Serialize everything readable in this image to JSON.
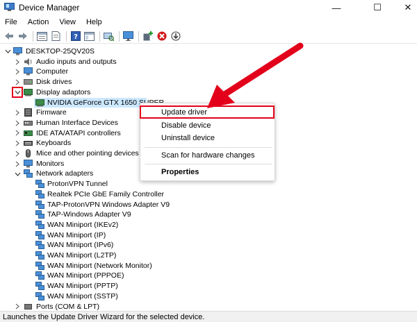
{
  "window": {
    "title": "Device Manager",
    "min_glyph": "—",
    "max_glyph": "☐",
    "close_glyph": "✕"
  },
  "menu": [
    "File",
    "Action",
    "View",
    "Help"
  ],
  "toolbar": {
    "icons": [
      "back-arrow-icon",
      "forward-arrow-icon",
      "properties-window-icon",
      "document-icon",
      "help-icon",
      "toolbar-window-icon",
      "scan-hardware-icon",
      "monitor-icon",
      "add-driver-icon",
      "remove-device-icon",
      "download-icon"
    ]
  },
  "tree": {
    "root": "DESKTOP-25QV20S",
    "items": [
      {
        "label": "Audio inputs and outputs",
        "icon": "speaker-icon"
      },
      {
        "label": "Computer",
        "icon": "computer-icon"
      },
      {
        "label": "Disk drives",
        "icon": "disk-icon"
      },
      {
        "label": "Display adaptors",
        "icon": "display-adapter-icon",
        "expanded": true
      },
      {
        "label": "NVIDIA GeForce GTX 1650 SUPER",
        "icon": "display-adapter-icon",
        "child": true,
        "selected": true
      },
      {
        "label": "Firmware",
        "icon": "firmware-icon"
      },
      {
        "label": "Human Interface Devices",
        "icon": "hid-icon"
      },
      {
        "label": "IDE ATA/ATAPI controllers",
        "icon": "ide-controller-icon"
      },
      {
        "label": "Keyboards",
        "icon": "keyboard-icon"
      },
      {
        "label": "Mice and other pointing devices",
        "icon": "mouse-icon"
      },
      {
        "label": "Monitors",
        "icon": "monitor-icon"
      },
      {
        "label": "Network adapters",
        "icon": "network-adapter-icon",
        "expanded": true
      },
      {
        "label": "ProtonVPN Tunnel",
        "icon": "network-adapter-icon",
        "child": true
      },
      {
        "label": "Realtek PCIe GbE Family Controller",
        "icon": "network-adapter-icon",
        "child": true
      },
      {
        "label": "TAP-ProtonVPN Windows Adapter V9",
        "icon": "network-adapter-icon",
        "child": true
      },
      {
        "label": "TAP-Windows Adapter V9",
        "icon": "network-adapter-icon",
        "child": true
      },
      {
        "label": "WAN Miniport (IKEv2)",
        "icon": "network-adapter-icon",
        "child": true
      },
      {
        "label": "WAN Miniport (IP)",
        "icon": "network-adapter-icon",
        "child": true
      },
      {
        "label": "WAN Miniport (IPv6)",
        "icon": "network-adapter-icon",
        "child": true
      },
      {
        "label": "WAN Miniport (L2TP)",
        "icon": "network-adapter-icon",
        "child": true
      },
      {
        "label": "WAN Miniport (Network Monitor)",
        "icon": "network-adapter-icon",
        "child": true
      },
      {
        "label": "WAN Miniport (PPPOE)",
        "icon": "network-adapter-icon",
        "child": true
      },
      {
        "label": "WAN Miniport (PPTP)",
        "icon": "network-adapter-icon",
        "child": true
      },
      {
        "label": "WAN Miniport (SSTP)",
        "icon": "network-adapter-icon",
        "child": true
      },
      {
        "label": "Ports (COM & LPT)",
        "icon": "ports-icon"
      }
    ]
  },
  "context_menu": {
    "update": "Update driver",
    "disable": "Disable device",
    "uninstall": "Uninstall device",
    "scan": "Scan for hardware changes",
    "properties": "Properties"
  },
  "status": "Launches the Update Driver Wizard for the selected device.",
  "colors": {
    "highlight_red": "#e3001b",
    "selection": "#cce8ff",
    "arrow_red": "#e3001b"
  }
}
